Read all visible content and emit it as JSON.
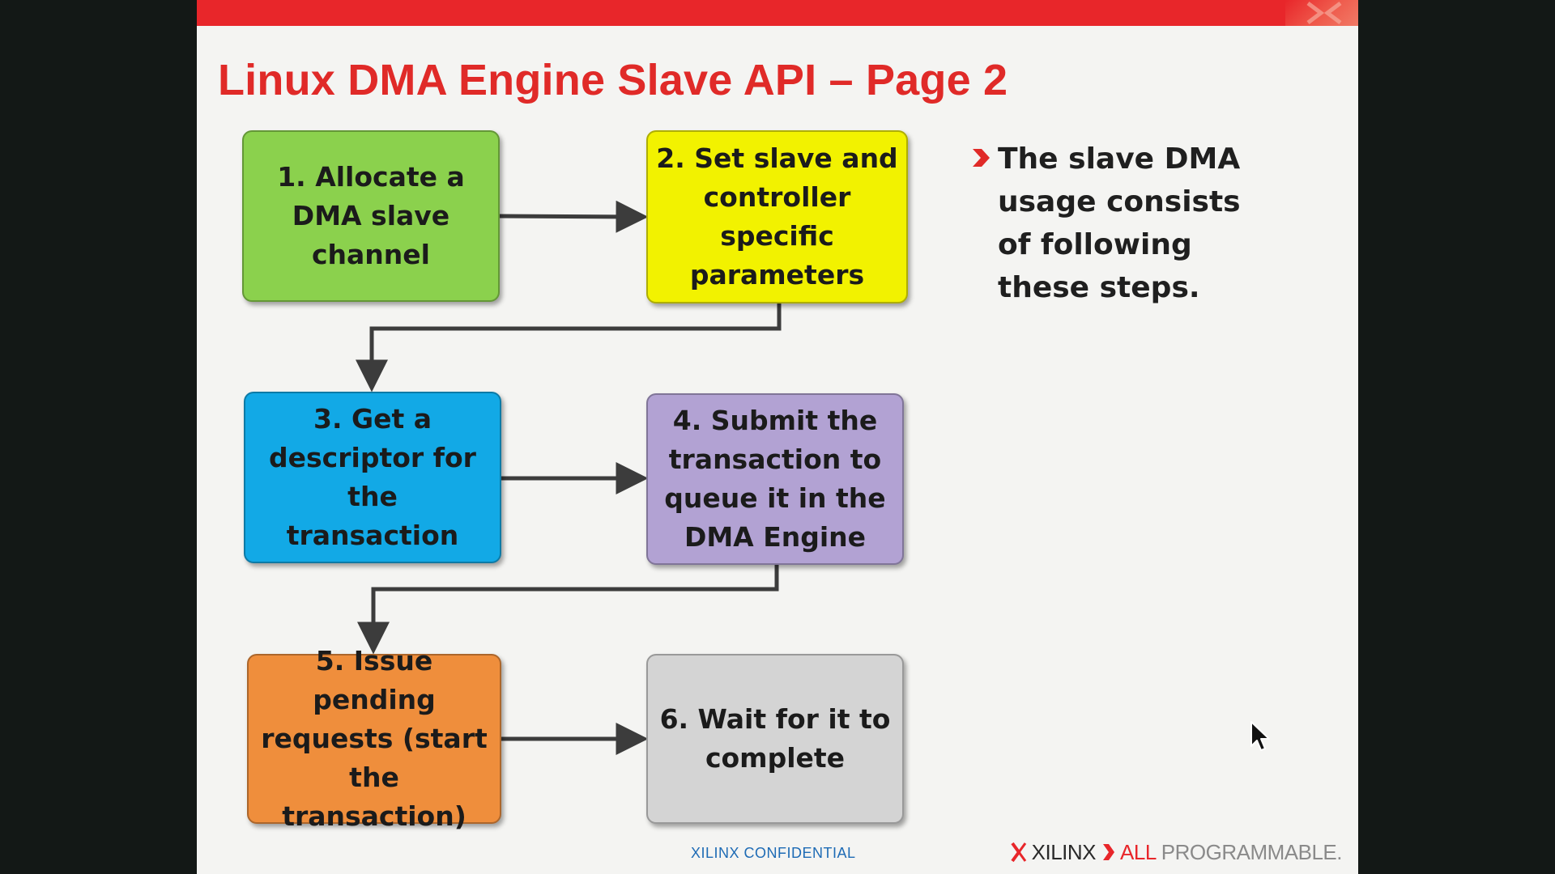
{
  "title": "Linux DMA Engine Slave API – Page 2",
  "steps": [
    {
      "label": "1. Allocate a\nDMA slave\nchannel",
      "color": "#8bd14d"
    },
    {
      "label": "2. Set slave and\ncontroller specific\nparameters",
      "color": "#f2f200"
    },
    {
      "label": "3. Get a\ndescriptor for the\ntransaction",
      "color": "#12a9e6"
    },
    {
      "label": "4. Submit the\ntransaction to\nqueue it in the\nDMA Engine",
      "color": "#b2a2d3"
    },
    {
      "label": "5. Issue pending\nrequests (start\nthe transaction)",
      "color": "#ef8e3c"
    },
    {
      "label": "6. Wait for it to\ncomplete",
      "color": "#d4d4d4"
    }
  ],
  "bullet": {
    "text": "The slave DMA usage consists of following these steps.",
    "icon": "chevron-right-icon",
    "icon_color": "#e02a28"
  },
  "footer": {
    "confidential": "XILINX CONFIDENTIAL",
    "logo_brand": "XILINX",
    "logo_all": "ALL",
    "logo_programmable": "PROGRAMMABLE."
  },
  "colors": {
    "accent_red": "#e8262a",
    "title_red": "#e02a28",
    "confidential_blue": "#1e6bb5"
  }
}
